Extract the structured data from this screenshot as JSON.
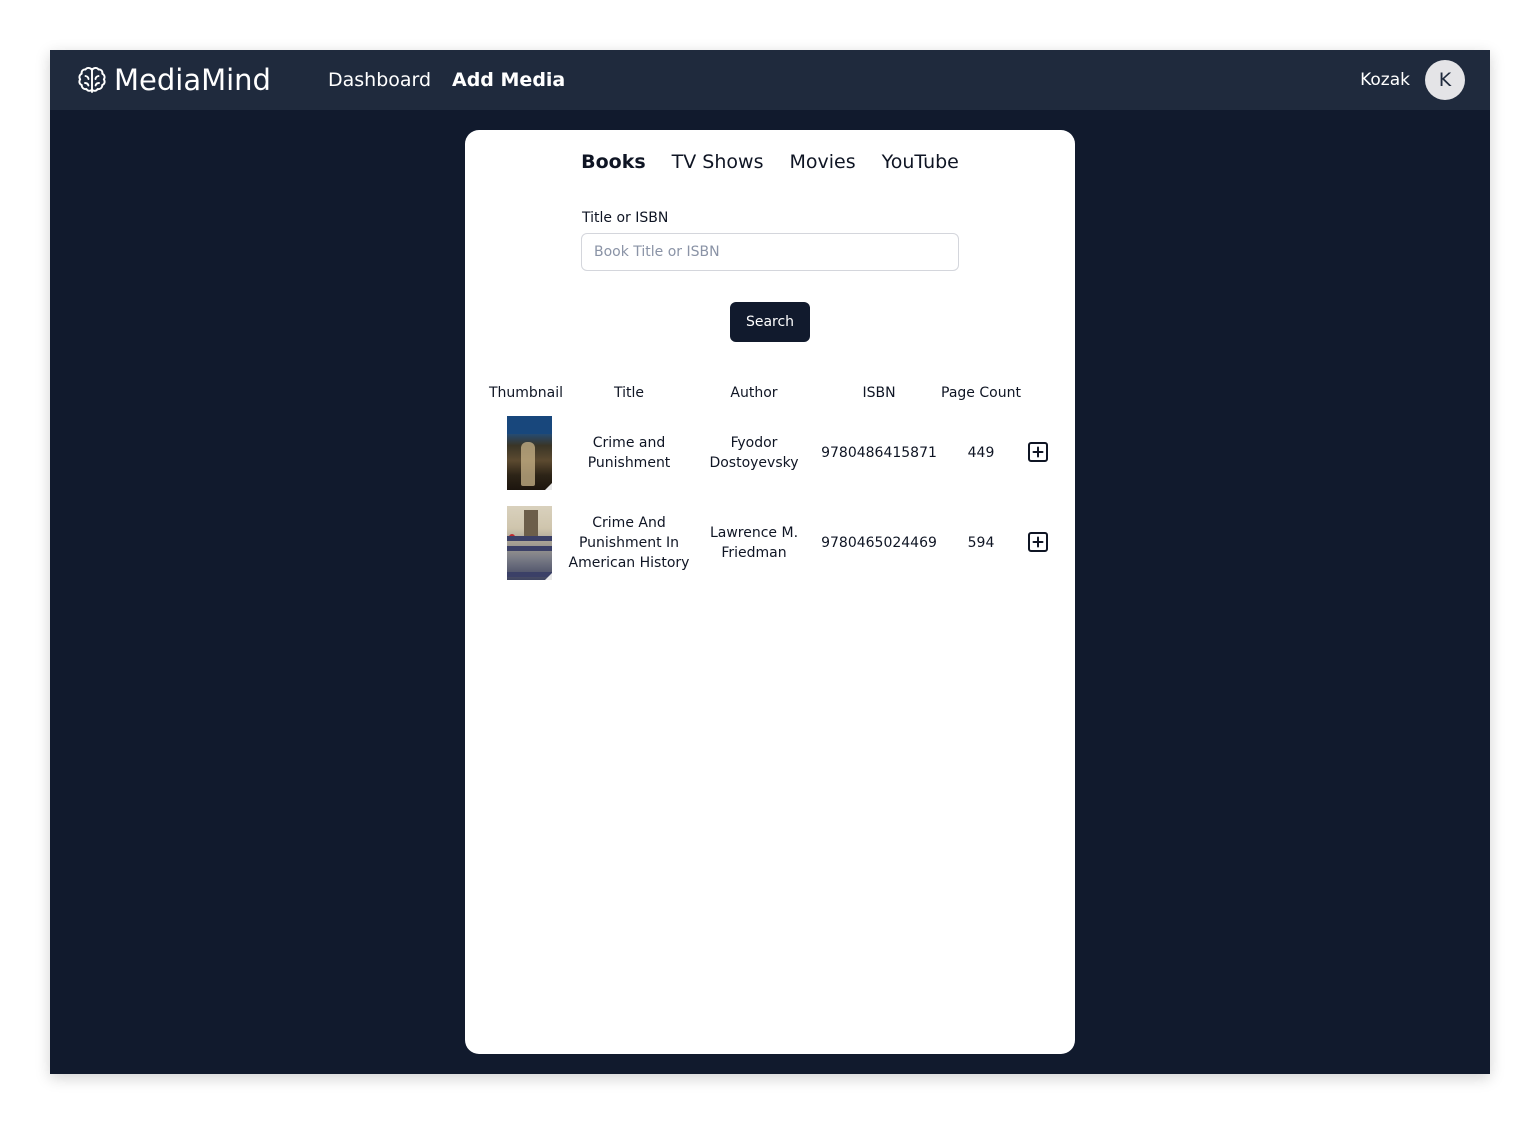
{
  "navbar": {
    "brand": "MediaMind",
    "brand_icon": "brain-icon",
    "links": [
      {
        "label": "Dashboard",
        "active": false
      },
      {
        "label": "Add Media",
        "active": true
      }
    ],
    "user_name": "Kozak",
    "avatar_initial": "K"
  },
  "tabs": [
    {
      "label": "Books",
      "active": true
    },
    {
      "label": "TV Shows",
      "active": false
    },
    {
      "label": "Movies",
      "active": false
    },
    {
      "label": "YouTube",
      "active": false
    }
  ],
  "search": {
    "label": "Title or ISBN",
    "value": "",
    "placeholder": "Book Title or ISBN",
    "button_label": "Search"
  },
  "results": {
    "columns": [
      "Thumbnail",
      "Title",
      "Author",
      "ISBN",
      "Page Count"
    ],
    "rows": [
      {
        "title": "Crime and Punishment",
        "author": "Fyodor Dostoyevsky",
        "isbn": "9780486415871",
        "page_count": "449",
        "add_icon": "plus-square-icon"
      },
      {
        "title": "Crime And Punishment In American History",
        "author": "Lawrence M. Friedman",
        "isbn": "9780465024469",
        "page_count": "594",
        "add_icon": "plus-square-icon"
      }
    ]
  },
  "colors": {
    "background": "#111a2d",
    "navbar": "#1f2a3d",
    "panel": "#ffffff",
    "button": "#111a2d",
    "text": "#0f1524"
  }
}
